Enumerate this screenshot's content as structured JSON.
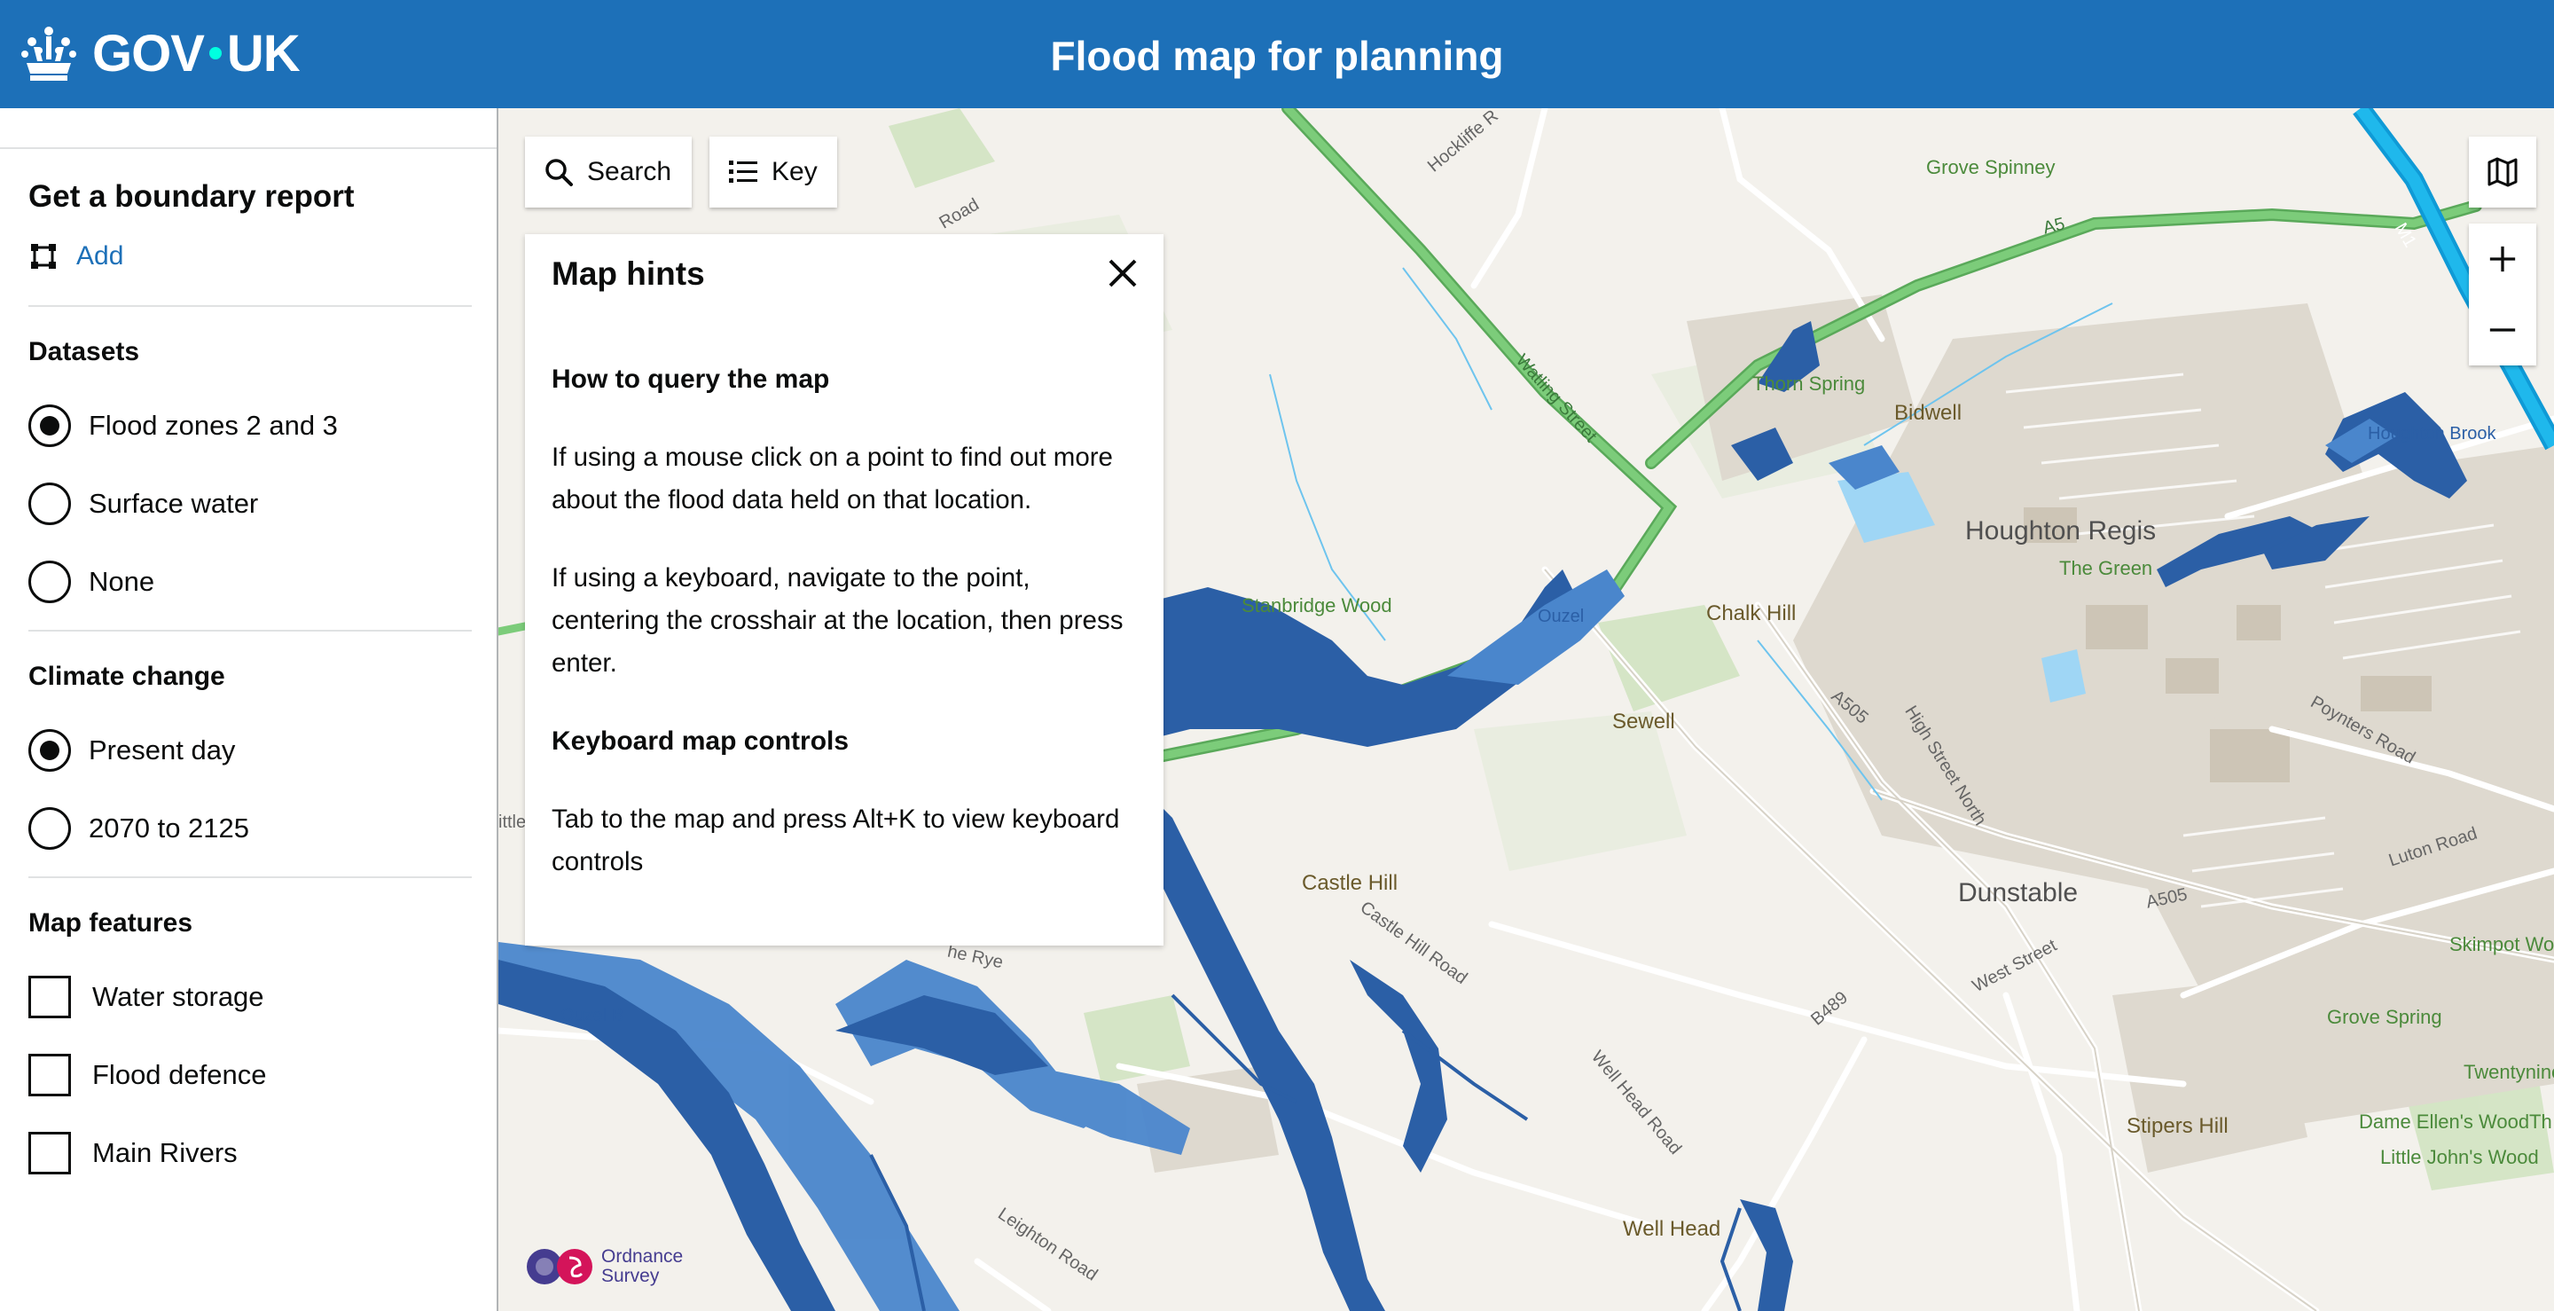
{
  "header": {
    "logo_text_left": "GOV",
    "logo_text_right": "UK",
    "title": "Flood map for planning"
  },
  "sidebar": {
    "boundary": {
      "heading": "Get a boundary report",
      "add_label": "Add"
    },
    "datasets": {
      "heading": "Datasets",
      "options": [
        {
          "label": "Flood zones 2 and 3",
          "selected": true
        },
        {
          "label": "Surface water",
          "selected": false
        },
        {
          "label": "None",
          "selected": false
        }
      ]
    },
    "climate": {
      "heading": "Climate change",
      "options": [
        {
          "label": "Present day",
          "selected": true
        },
        {
          "label": "2070 to 2125",
          "selected": false
        }
      ]
    },
    "features": {
      "heading": "Map features",
      "options": [
        {
          "label": "Water storage",
          "checked": false
        },
        {
          "label": "Flood defence",
          "checked": false
        },
        {
          "label": "Main Rivers",
          "checked": false
        }
      ]
    }
  },
  "map": {
    "search_label": "Search",
    "key_label": "Key",
    "attribution": {
      "line1": "Ordnance",
      "line2": "Survey"
    },
    "places": [
      "Grove Spinney",
      "Thorn Spring",
      "Bidwell",
      "Houghton Regis",
      "The Green",
      "Stanbridge Wood",
      "Chalk Hill",
      "Sewell",
      "Castle Hill",
      "Dunstable",
      "Skimpot Wood",
      "Grove Spring",
      "Twentynine",
      "Stipers Hill",
      "Dame Ellen's Wood",
      "Little John's Wood",
      "Well Head",
      "Houghton Brook",
      "Ouzel",
      "Th",
      "ittle"
    ],
    "roads": [
      "A5",
      "Watling Street",
      "M1",
      "A505",
      "High Street North",
      "Poynters Road",
      "Luton Road",
      "A505",
      "West Street",
      "B489",
      "Castle Hill Road",
      "Well Head Road",
      "Leighton Road",
      "Hockliffe R",
      "Road",
      "he Rye",
      "Ouzel B"
    ]
  },
  "hints": {
    "title": "Map hints",
    "query_heading": "How to query the map",
    "mouse_text": "If using a mouse click on a point to find out more about the flood data held on that location.",
    "keyboard_text": "If using a keyboard, navigate to the point, centering the crosshair at the location, then press enter.",
    "controls_heading": "Keyboard map controls",
    "controls_text": "Tab to the map and press Alt+K to view keyboard controls"
  },
  "colors": {
    "header": "#1d70b8",
    "link": "#1d70b8",
    "flood_dark": "#2b5fa6",
    "flood_light": "#4d8ad0",
    "trunk_road": "#6cc06c",
    "motorway": "#19b3e6"
  }
}
